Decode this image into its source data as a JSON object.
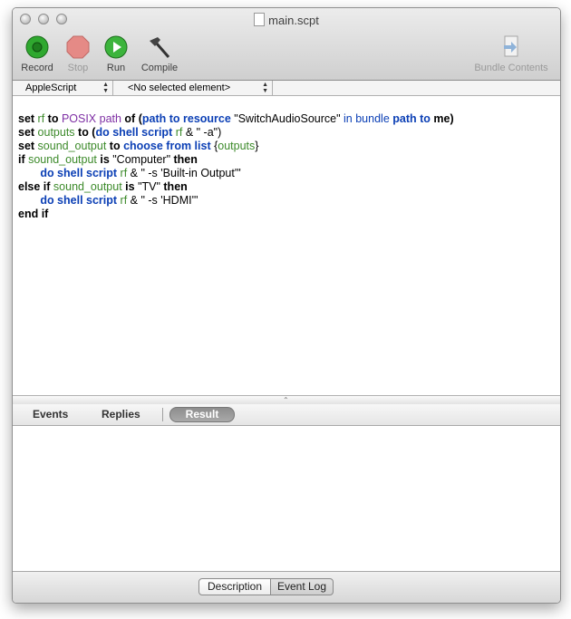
{
  "window": {
    "title": "main.scpt"
  },
  "toolbar": {
    "record_label": "Record",
    "stop_label": "Stop",
    "run_label": "Run",
    "compile_label": "Compile",
    "bundle_label": "Bundle Contents"
  },
  "navbar": {
    "language": "AppleScript",
    "element": "<No selected element>"
  },
  "tabs": {
    "events": "Events",
    "replies": "Replies",
    "result": "Result"
  },
  "bottom": {
    "description": "Description",
    "event_log": "Event Log"
  },
  "code": {
    "l1": [
      [
        "kw",
        "set "
      ],
      [
        "var",
        "rf"
      ],
      [
        "op",
        " to "
      ],
      [
        "cls",
        "POSIX path"
      ],
      [
        "op",
        " of "
      ],
      [
        "op",
        "("
      ],
      [
        "cmd",
        "path to resource"
      ],
      [
        "op",
        " \"SwitchAudioSource\" "
      ],
      [
        "prop",
        "in bundle"
      ],
      [
        "op",
        " "
      ],
      [
        "cmd",
        "path to"
      ],
      [
        "op",
        " "
      ],
      [
        "kw",
        "me"
      ],
      [
        "op",
        ")"
      ]
    ],
    "lines": [
      "set rf to POSIX path of (path to resource \"SwitchAudioSource\" in bundle path to me)",
      "set outputs to (do shell script rf & \" -a\")",
      "set sound_output to choose from list {outputs}",
      "if sound_output is \"Computer\" then",
      "do shell script rf & \" -s 'Built-in Output'\"",
      "else if sound_output is \"TV\" then",
      "do shell script rf & \" -s 'HDMI'\"",
      "end if"
    ]
  },
  "colors": {
    "keyword": "#0000ff",
    "variable": "#3c8a2a",
    "class": "#7e2fa4",
    "command": "#0b3fb5",
    "record_green": "#2fa82f",
    "stop_red": "#d9534f"
  }
}
